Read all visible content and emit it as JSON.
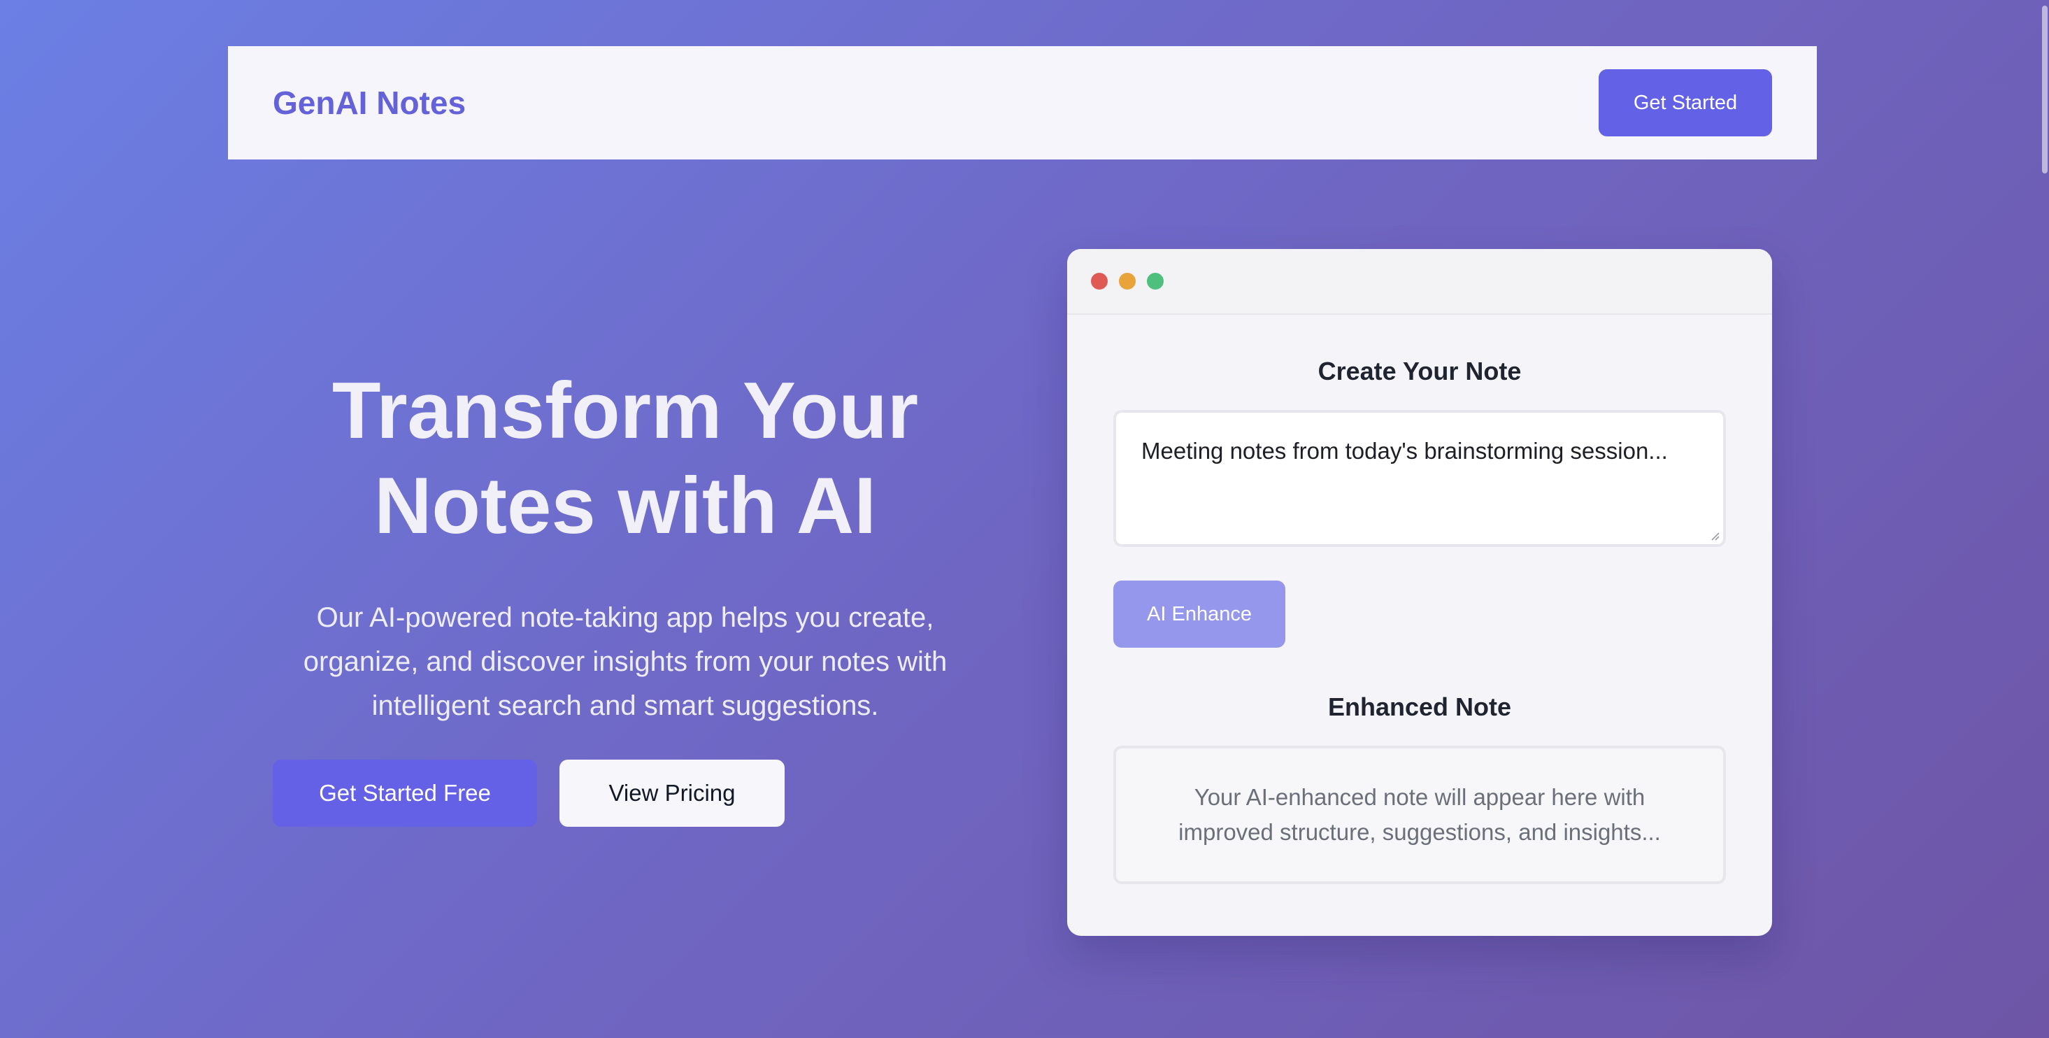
{
  "header": {
    "brand": "GenAI Notes",
    "cta_label": "Get Started"
  },
  "hero": {
    "title_line1": "Transform Your",
    "title_line2": "Notes with AI",
    "subtitle": "Our AI-powered note-taking app helps you create, organize, and discover insights from your notes with intelligent search and smart suggestions.",
    "primary_cta": "Get Started Free",
    "secondary_cta": "View Pricing"
  },
  "demo": {
    "window_dots": [
      "#e05a55",
      "#e8a33b",
      "#4fbf7d"
    ],
    "create_heading": "Create Your Note",
    "note_input_value": "Meeting notes from today's brainstorming session...",
    "enhance_button": "AI Enhance",
    "enhanced_heading": "Enhanced Note",
    "enhanced_placeholder": "Your AI-enhanced note will appear here with improved structure, suggestions, and insights..."
  },
  "colors": {
    "brand": "#6462d9",
    "primary": "#6361e6",
    "enhance_disabled": "#9497ec"
  }
}
